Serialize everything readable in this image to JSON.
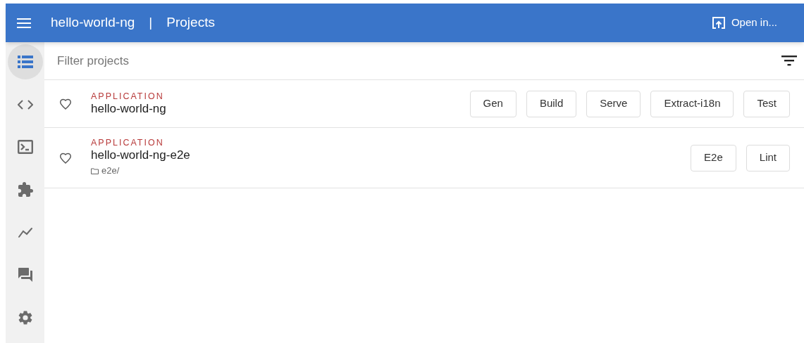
{
  "toolbar": {
    "workspace": "hello-world-ng",
    "separator": "|",
    "page": "Projects",
    "open_in": "Open in..."
  },
  "sidebar": {
    "items": [
      {
        "kind": "list",
        "selected": true
      },
      {
        "kind": "code",
        "selected": false
      },
      {
        "kind": "terminal",
        "selected": false
      },
      {
        "kind": "puzzle",
        "selected": false
      },
      {
        "kind": "chart",
        "selected": false
      },
      {
        "kind": "chat",
        "selected": false
      },
      {
        "kind": "gear",
        "selected": false
      }
    ]
  },
  "filter": {
    "placeholder": "Filter projects"
  },
  "projects": [
    {
      "type": "APPLICATION",
      "name": "hello-world-ng",
      "favorite": false,
      "actions": [
        "Gen",
        "Build",
        "Serve",
        "Extract-i18n",
        "Test"
      ]
    },
    {
      "type": "APPLICATION",
      "name": "hello-world-ng-e2e",
      "favorite": false,
      "path": "e2e/",
      "actions": [
        "E2e",
        "Lint"
      ]
    }
  ]
}
